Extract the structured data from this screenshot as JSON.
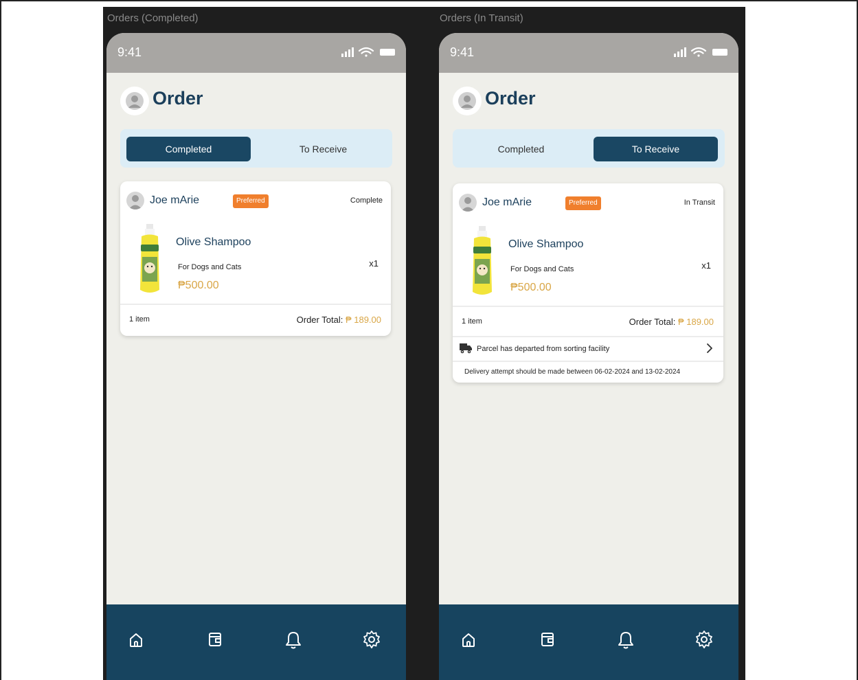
{
  "frames": [
    {
      "label": "Orders (Completed)",
      "time": "9:41",
      "title": "Order",
      "tabs": [
        {
          "label": "Completed",
          "active": true
        },
        {
          "label": "To Receive",
          "active": false
        }
      ],
      "order": {
        "seller": "Joe mArie",
        "badge": "Preferred",
        "status": "Complete",
        "product_name": "Olive Shampoo",
        "product_sub": "For Dogs and Cats",
        "price": "₱500.00",
        "qty": "x1",
        "items": "1 item",
        "total_label": "Order Total:",
        "total_value": "₱ 189.00"
      },
      "nav": [
        "home-icon",
        "wallet-icon",
        "bell-icon",
        "gear-icon"
      ]
    },
    {
      "label": "Orders (In Transit)",
      "time": "9:41",
      "title": "Order",
      "tabs": [
        {
          "label": "Completed",
          "active": false
        },
        {
          "label": "To Receive",
          "active": true
        }
      ],
      "order": {
        "seller": "Joe mArie",
        "badge": "Preferred",
        "status": "In Transit",
        "product_name": "Olive Shampoo",
        "product_sub": "For Dogs and Cats",
        "price": "₱500.00",
        "qty": "x1",
        "items": "1 item",
        "total_label": "Order Total:",
        "total_value": "₱ 189.00",
        "tracking": "Parcel has departed from sorting facility",
        "delivery": "Delivery attempt should be made between 06-02-2024 and 13-02-2024"
      },
      "nav": [
        "home-icon",
        "wallet-icon",
        "bell-icon",
        "gear-icon"
      ]
    }
  ],
  "colors": {
    "navy": "#1a4763",
    "title": "#1b3f5b",
    "badge": "#f07f2d",
    "price": "#d9a646",
    "tab_bg": "#dcedf6",
    "screen_bg": "#efefea"
  }
}
